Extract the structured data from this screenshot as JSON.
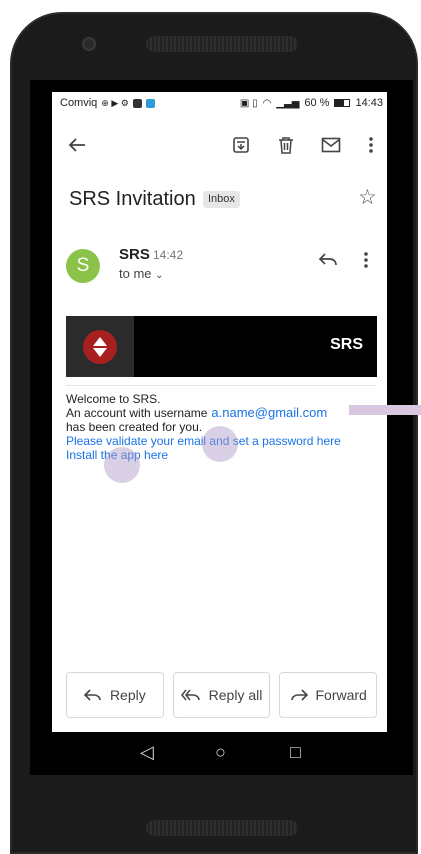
{
  "status": {
    "carrier": "Comviq",
    "battery": "60 %",
    "time": "14:43"
  },
  "toolbar": {
    "icons": [
      "back-arrow-icon",
      "archive-icon",
      "trash-icon",
      "mail-icon",
      "more-vert-icon"
    ]
  },
  "email": {
    "subject": "SRS Invitation",
    "label": "Inbox",
    "sender": "SRS",
    "sender_initial": "S",
    "time": "14:42",
    "recipient": "to me",
    "banner_title": "SRS",
    "body": {
      "line1": "Welcome to SRS.",
      "line2_prefix": "An account with username",
      "username": "a.name@gmail.com",
      "line3": "has been created for you.",
      "link_validate": "Please validate your email and set a password here",
      "link_install": "Install the app here"
    }
  },
  "actions": {
    "reply": "Reply",
    "reply_all": "Reply all",
    "forward": "Forward"
  },
  "colors": {
    "avatar": "#8bc34a",
    "link": "#1a73e8",
    "banner": "#000000",
    "logo": "#a81f1f"
  }
}
